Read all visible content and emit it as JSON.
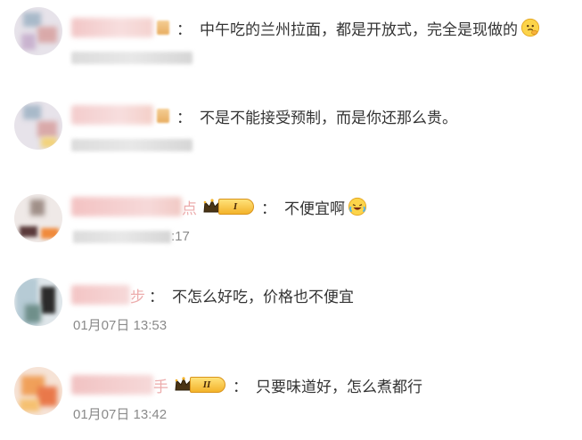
{
  "comments": [
    {
      "text": "中午吃的兰州拉面，都是开放式，完全是现做的",
      "colon": "：",
      "emoji": "thinking-face-emoji",
      "time": ""
    },
    {
      "text": "不是不能接受预制，而是你还那么贵。",
      "colon": "：",
      "time": ""
    },
    {
      "name_tail": "点",
      "rank": "I",
      "text": "不便宜啊",
      "colon": "：",
      "emoji": "laughing-crying-emoji",
      "time_tail": ":17"
    },
    {
      "name_tail": "步",
      "text": "不怎么好吃，价格也不便宜",
      "colon": "：",
      "time": "01月07日 13:53"
    },
    {
      "name_tail": "手",
      "rank": "II",
      "text": "只要味道好，怎么煮都行",
      "colon": "：",
      "time": "01月07日 13:42"
    }
  ],
  "colors": {
    "text": "#333333",
    "time": "#8a8a8a",
    "badge_gold": "#f3b32b"
  }
}
